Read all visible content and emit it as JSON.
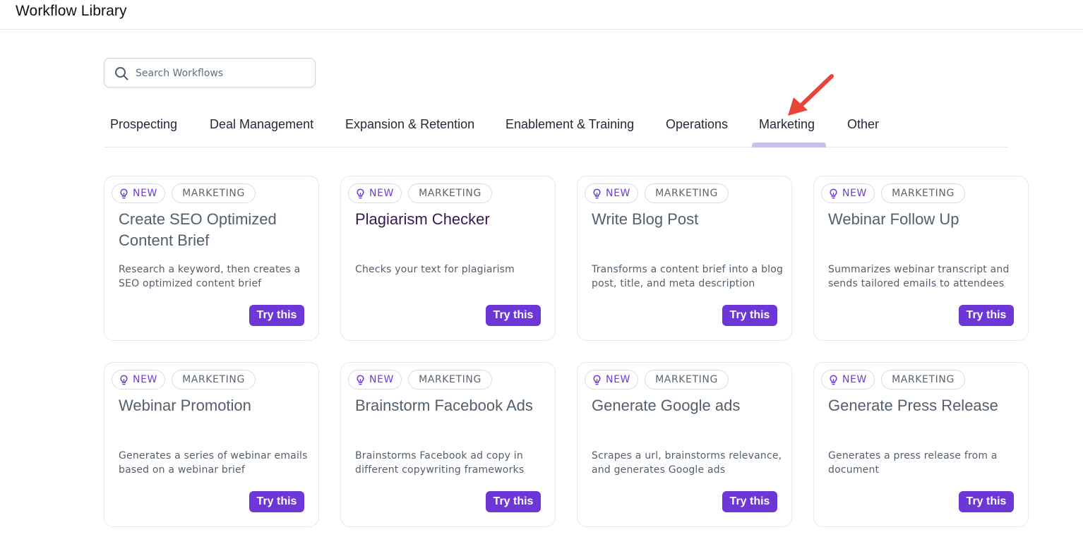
{
  "header": {
    "title": "Workflow Library"
  },
  "search": {
    "placeholder": "Search Workflows",
    "value": ""
  },
  "tabs": [
    {
      "label": "Prospecting"
    },
    {
      "label": "Deal Management"
    },
    {
      "label": "Expansion & Retention"
    },
    {
      "label": "Enablement & Training"
    },
    {
      "label": "Operations"
    },
    {
      "label": "Marketing",
      "active": true
    },
    {
      "label": "Other"
    }
  ],
  "badges": {
    "new": "NEW",
    "category": "MARKETING"
  },
  "try_label": "Try this",
  "cards": [
    {
      "title": "Create SEO Optimized Content Brief",
      "description": "Research a keyword, then creates a SEO optimized content brief"
    },
    {
      "title": "Plagiarism Checker",
      "description": "Checks your text for plagiarism"
    },
    {
      "title": "Write Blog Post",
      "description": "Transforms a content brief into a blog post, title, and meta description"
    },
    {
      "title": "Webinar Follow Up",
      "description": "Summarizes webinar transcript and sends tailored emails to attendees"
    },
    {
      "title": "Webinar Promotion",
      "description": "Generates a series of webinar emails based on a webinar brief"
    },
    {
      "title": "Brainstorm Facebook Ads",
      "description": "Brainstorms Facebook ad copy in different copywriting frameworks"
    },
    {
      "title": "Generate Google ads",
      "description": "Scrapes a url, brainstorms relevance, and generates Google ads"
    },
    {
      "title": "Generate Press Release",
      "description": "Generates a press release from a document"
    }
  ],
  "colors": {
    "accent": "#6d36d6",
    "tab_indicator": "#c7c1ec",
    "annotation_arrow": "#e8443a"
  }
}
